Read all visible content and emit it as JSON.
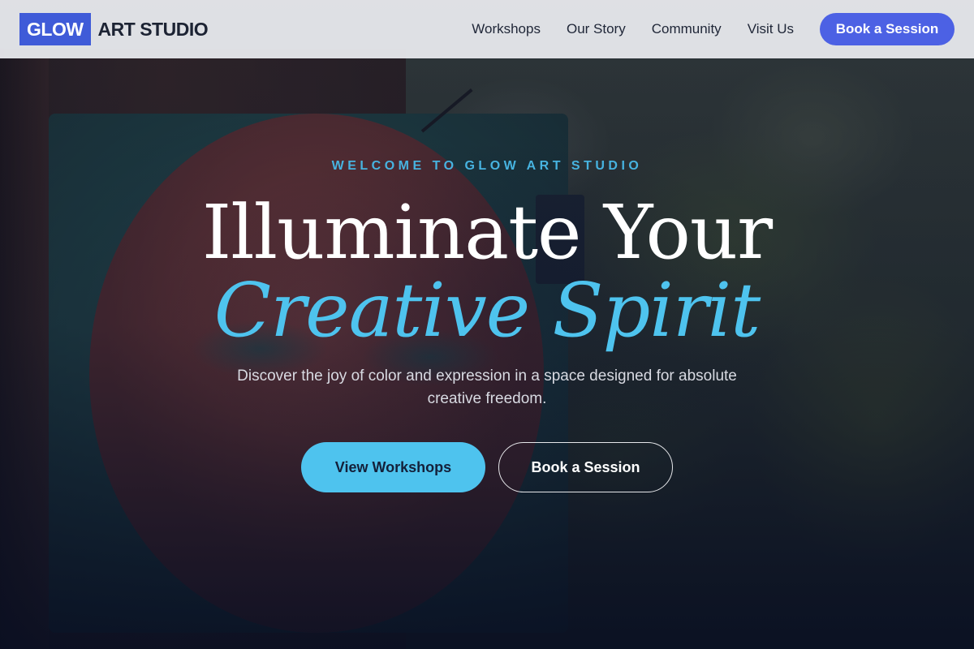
{
  "header": {
    "logo": {
      "mark": "GLOW",
      "text": "ART STUDIO"
    },
    "nav": [
      {
        "label": "Workshops"
      },
      {
        "label": "Our Story"
      },
      {
        "label": "Community"
      },
      {
        "label": "Visit Us"
      }
    ],
    "cta_label": "Book a Session"
  },
  "hero": {
    "eyebrow": "WELCOME TO GLOW ART STUDIO",
    "title_line1": "Illuminate Your",
    "title_line2": "Creative Spirit",
    "subtitle": "Discover the joy of color and expression in a space designed for absolute creative freedom.",
    "primary_button": "View Workshops",
    "secondary_button": "Book a Session"
  },
  "colors": {
    "brand_blue": "#4c61e4",
    "accent_cyan": "#4ec3ee",
    "header_bg": "#e6e7eb"
  }
}
